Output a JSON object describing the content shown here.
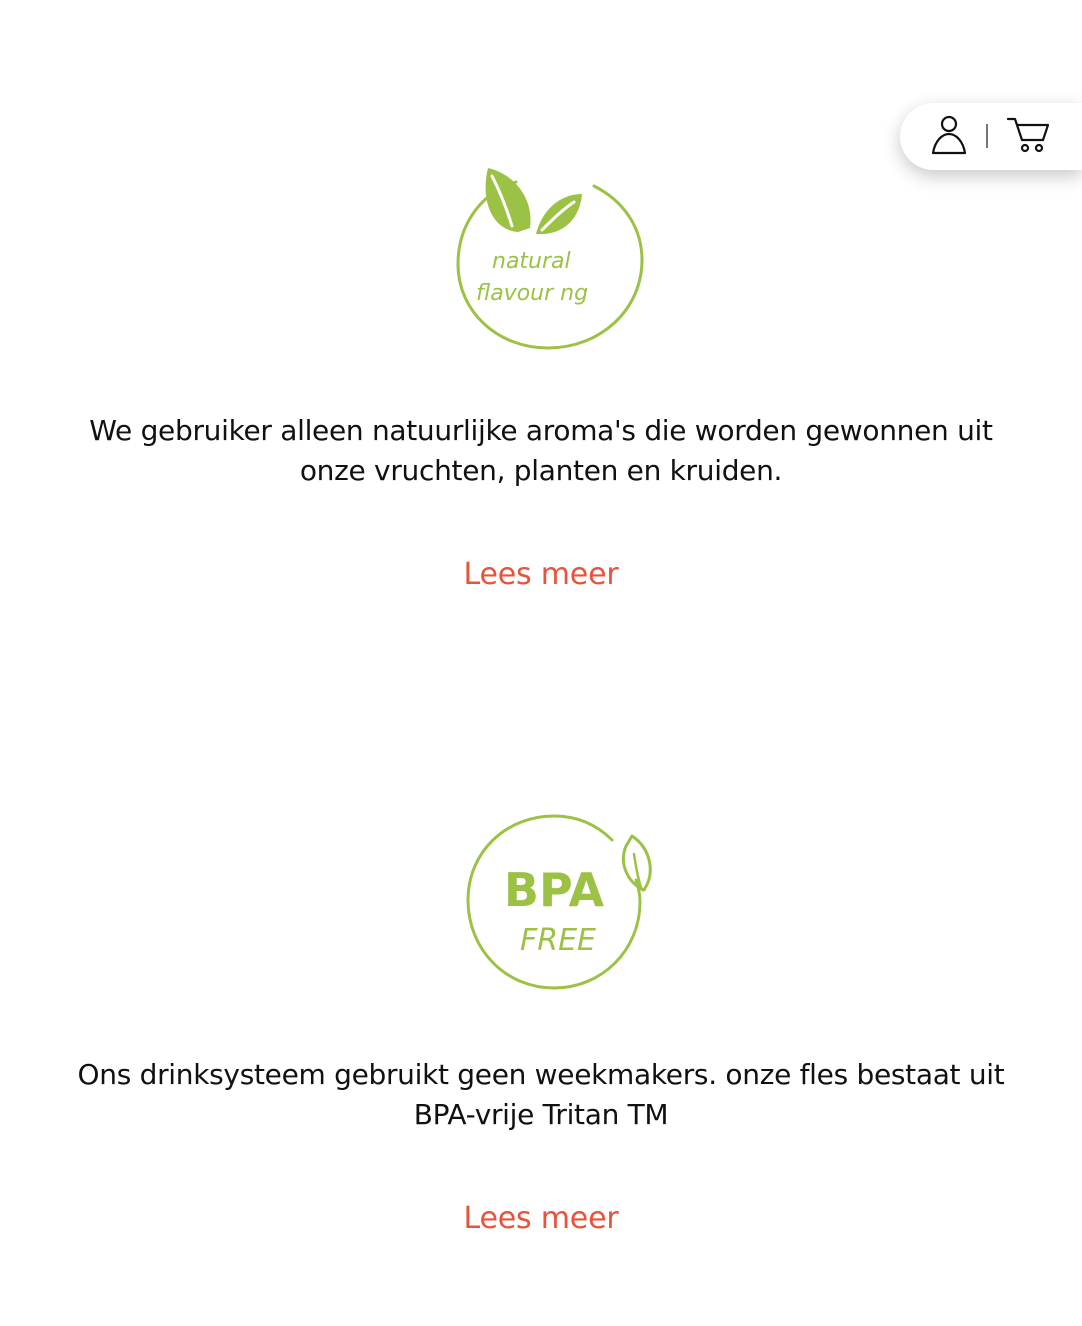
{
  "colors": {
    "badge_green": "#9cc245",
    "link": "#e8533b",
    "text": "#111111",
    "background": "#ffffff"
  },
  "header": {
    "account_icon": "user-icon",
    "cart_icon": "cart-icon"
  },
  "features": [
    {
      "badge_icon": "leaves-icon",
      "badge_line1": "natural",
      "badge_line2": "flavour ng",
      "text": "We gebruiker alleen natuurlijke aroma's die worden gewonnen uit onze vruchten, planten en kruiden.",
      "link": "Lees meer"
    },
    {
      "badge_icon": "leaf-icon",
      "badge_line1": "BPA",
      "badge_line2": "FREE",
      "text": "Ons drinksysteem gebruikt geen weekmakers. onze fles bestaat uit BPA-vrije Tritan TM",
      "link": "Lees meer"
    }
  ]
}
